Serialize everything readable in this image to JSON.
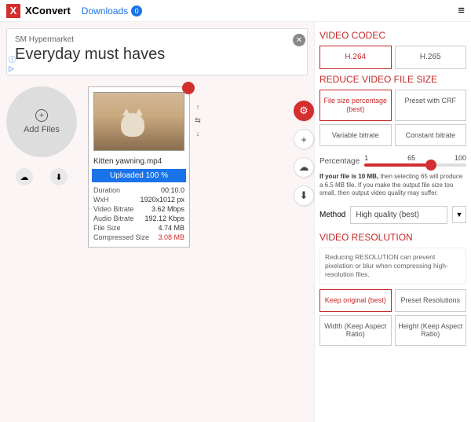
{
  "header": {
    "brand": "XConvert",
    "downloads_label": "Downloads",
    "downloads_count": "0"
  },
  "ad": {
    "sub": "SM Hypermarket",
    "title": "Everyday must haves"
  },
  "add_files": {
    "label": "Add Files"
  },
  "file": {
    "name": "Kitten yawning.mp4",
    "upload_status": "Uploaded 100 %",
    "rows": [
      {
        "k": "Duration",
        "v": "00:10.0"
      },
      {
        "k": "WxH",
        "v": "1920x1012 px"
      },
      {
        "k": "Video Bitrate",
        "v": "3.62 Mbps"
      },
      {
        "k": "Audio Bitrate",
        "v": "192.12 Kbps"
      },
      {
        "k": "File Size",
        "v": "4.74 MB"
      },
      {
        "k": "Compressed Size",
        "v": "3.08 MB"
      }
    ]
  },
  "panel": {
    "codec_title": "VIDEO CODEC",
    "codecs": [
      "H.264",
      "H.265"
    ],
    "reduce_title": "REDUCE VIDEO FILE SIZE",
    "reduce_opts": [
      "File size percentage (best)",
      "Preset with CRF",
      "Variable bitrate",
      "Constant bitrate"
    ],
    "percent_label": "Percentage",
    "ticks": {
      "min": "1",
      "mid": "65",
      "max": "100"
    },
    "hint_a": "If your file is 10 MB,",
    "hint_b": " then selecting 65 will produce a 6.5 MB file. If you make the output file size too small, then output video quality may suffer.",
    "method_label": "Method",
    "method_value": "High quality (best)",
    "res_title": "VIDEO RESOLUTION",
    "res_note": "Reducing RESOLUTION can prevent pixelation or blur when compressing high-resolution files.",
    "res_opts": [
      "Keep original (best)",
      "Preset Resolutions",
      "Width (Keep Aspect Ratio)",
      "Height (Keep Aspect Ratio)"
    ]
  }
}
